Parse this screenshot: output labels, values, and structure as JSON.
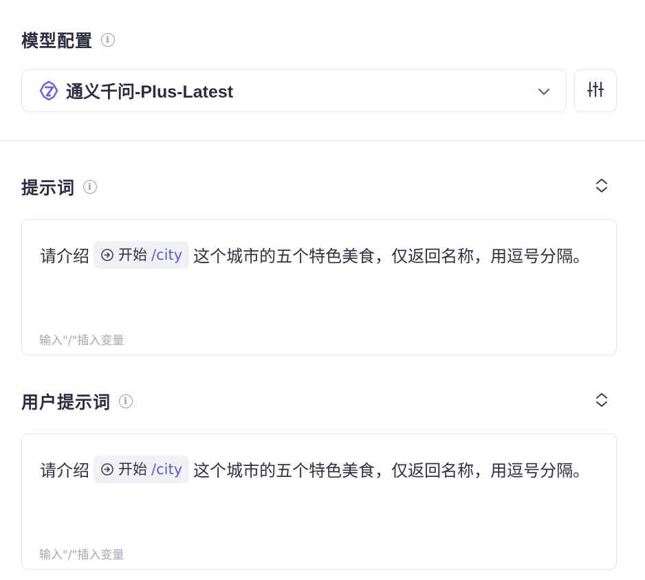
{
  "model_config": {
    "title": "模型配置",
    "model_name": "通义千问-Plus-Latest"
  },
  "prompt_section": {
    "title": "提示词",
    "text_before": "请介绍",
    "variable": {
      "source": "开始",
      "path": "/city"
    },
    "text_after": "这个城市的五个特色美食，仅返回名称，用逗号分隔。",
    "hint": "输入\"/\"插入变量"
  },
  "user_prompt_section": {
    "title": "用户提示词",
    "text_before": "请介绍",
    "variable": {
      "source": "开始",
      "path": "/city"
    },
    "text_after": "这个城市的五个特色美食，仅返回名称，用逗号分隔。",
    "hint": "输入\"/\"插入变量"
  },
  "colors": {
    "accent": "#5b5bd6",
    "border": "#e3e4ea",
    "chip_bg": "#f0f1f5",
    "muted": "#9a9ba8"
  }
}
